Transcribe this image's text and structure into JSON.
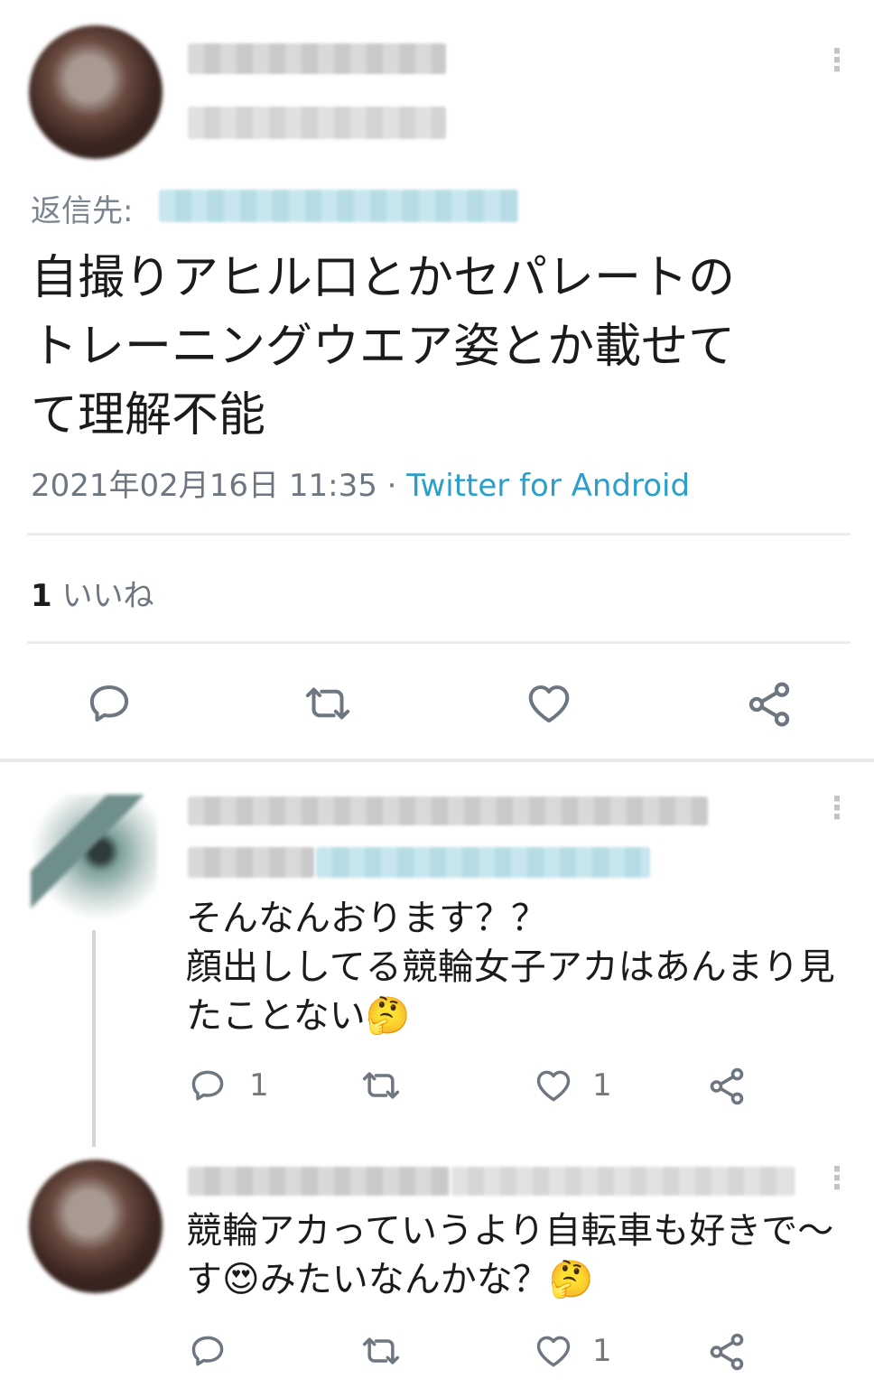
{
  "main_tweet": {
    "reply_prefix": "返信先:",
    "text_lines": [
      "自撮りアヒル口とかセパレートの",
      "トレーニングウエア姿とか載せて",
      "て理解不能"
    ],
    "timestamp": "2021年02月16日 11:35",
    "separator": " · ",
    "source": "Twitter for Android",
    "likes_count": "1",
    "likes_label": "いいね"
  },
  "replies": [
    {
      "text_lines": [
        "そんなんおります？？",
        "顔出ししてる競輪女子アカはあんまり見",
        "たことない"
      ],
      "emoji_end": "🤔",
      "reply_count": "1",
      "like_count": "1"
    },
    {
      "text_lines": [
        "競輪アカっていうより自転車も好きで～",
        "す",
        "みたいなんかな？"
      ],
      "emoji_mid": "😍",
      "emoji_end": "🤔",
      "like_count": "1"
    }
  ],
  "icons": [
    "more-vert-icon",
    "reply-icon",
    "retweet-icon",
    "like-icon",
    "share-icon"
  ],
  "colors": {
    "link": "#2a9fcc",
    "meta": "#6e7680",
    "text": "#1b1b1b"
  }
}
